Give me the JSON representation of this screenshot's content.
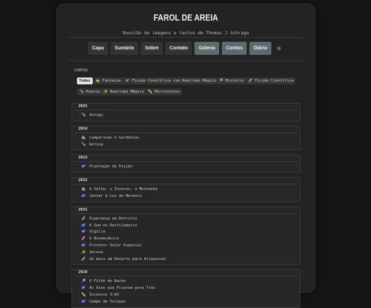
{
  "site": {
    "title": "FAROL DE AREIA",
    "subtitle": "Reunião de imagens e textos de Thomas J Schrage"
  },
  "nav": [
    {
      "label": "Capa",
      "active": false
    },
    {
      "label": "Sumário",
      "active": false
    },
    {
      "label": "Sobre",
      "active": false
    },
    {
      "label": "Contato",
      "active": false
    },
    {
      "label": "Galeria",
      "active": true
    },
    {
      "label": "Contos",
      "active": true
    },
    {
      "label": "Diário",
      "active": true
    }
  ],
  "nav_settings_icon": "gear-icon",
  "section_label": "CONTOS",
  "tags": [
    {
      "label": "Todos",
      "icon": "",
      "active": true
    },
    {
      "label": "Fantasia",
      "icon": "🧙",
      "active": false
    },
    {
      "label": "Ficção Científica com Realismo Mágico",
      "icon": "🌌",
      "active": false
    },
    {
      "label": "Mistério",
      "icon": "🔎",
      "active": false
    },
    {
      "label": "Ficção Científica",
      "icon": "🚀",
      "active": false
    },
    {
      "label": "Poesia",
      "icon": "🪶",
      "active": false
    },
    {
      "label": "Realismo Mágico",
      "icon": "✨",
      "active": false
    },
    {
      "label": "Microcontos",
      "icon": "✏️",
      "active": false
    }
  ],
  "years": [
    {
      "year": "2025",
      "stories": [
        {
          "icon": "🪶",
          "title": "Antigo"
        }
      ]
    },
    {
      "year": "2024",
      "stories": [
        {
          "icon": "🧙",
          "title": "Lamparinas e Gardênias"
        },
        {
          "icon": "🪶",
          "title": "Rotina"
        }
      ]
    },
    {
      "year": "2023",
      "stories": [
        {
          "icon": "🌌",
          "title": "Plantação de Feijão"
        }
      ]
    },
    {
      "year": "2022",
      "stories": [
        {
          "icon": "🧙",
          "title": "A Velha, o Inverno, a Montanha"
        },
        {
          "icon": "🌌",
          "title": "Jantar à Luz de Meteoro"
        }
      ]
    },
    {
      "year": "2021",
      "stories": [
        {
          "icon": "🚀",
          "title": "Esperança em Detritos"
        },
        {
          "icon": "🌌",
          "title": "O Som no Desfiladeiro"
        },
        {
          "icon": "🌌",
          "title": "Vigília"
        },
        {
          "icon": "🚀",
          "title": "O Biomecânico"
        },
        {
          "icon": "🌌",
          "title": "Protetor Solar Especial"
        },
        {
          "icon": "✨",
          "title": "Sereia"
        },
        {
          "icon": "🚀",
          "title": "Só mais um Deserto para Atravessar"
        }
      ]
    },
    {
      "year": "2019",
      "stories": [
        {
          "icon": "🔎",
          "title": "O Filho do Barão"
        },
        {
          "icon": "🌌",
          "title": "As Uvas que Ficaram para Trás"
        },
        {
          "icon": "✏️",
          "title": "Incensos 3:69"
        },
        {
          "icon": "🌌",
          "title": "Campo de Tulipas"
        }
      ]
    }
  ]
}
